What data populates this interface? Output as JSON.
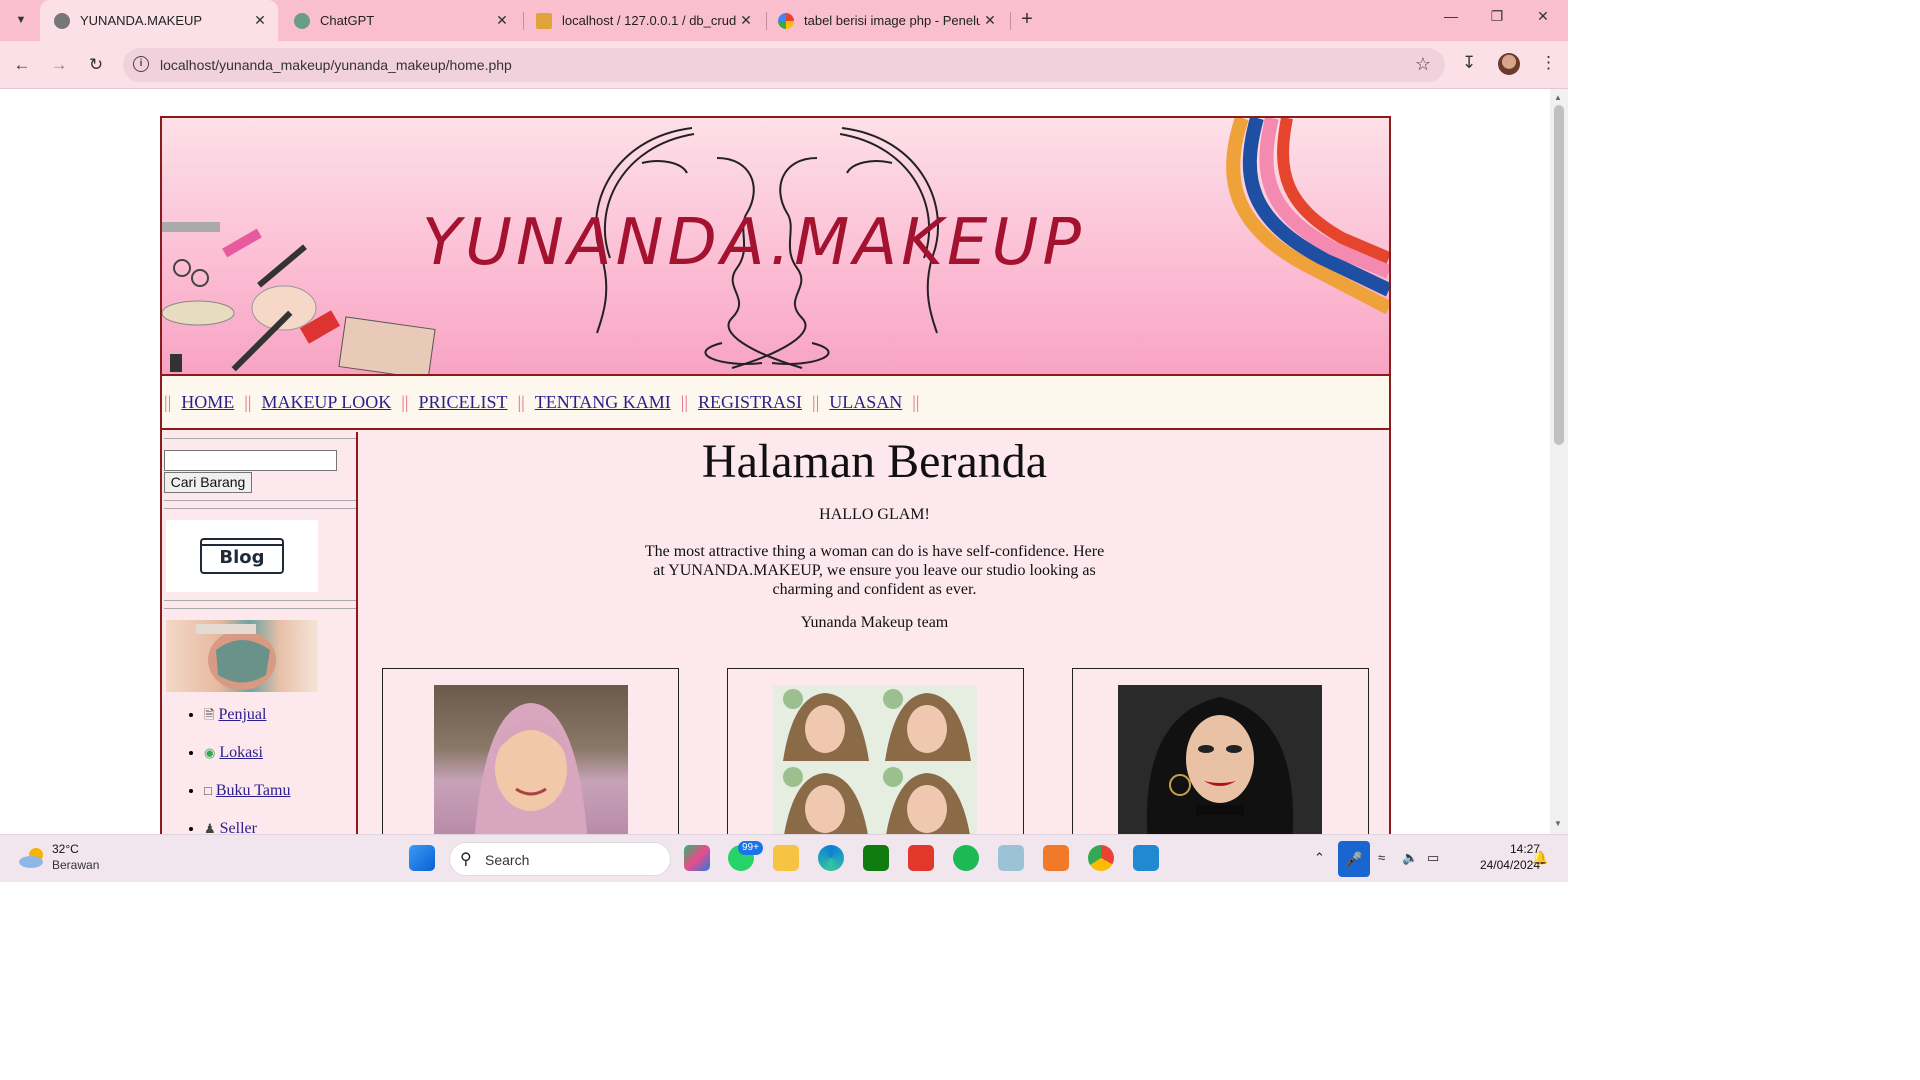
{
  "browser": {
    "tabs": [
      {
        "title": "YUNANDA.MAKEUP",
        "active": true
      },
      {
        "title": "ChatGPT",
        "active": false
      },
      {
        "title": "localhost / 127.0.0.1 / db_crud",
        "active": false
      },
      {
        "title": "tabel berisi image php - Penelu",
        "active": false
      }
    ],
    "url": "localhost/yunanda_makeup/yunanda_makeup/home.php"
  },
  "site": {
    "banner_title": "YUNANDA.MAKEUP",
    "menu": [
      {
        "label": "HOME"
      },
      {
        "label": "MAKEUP LOOK"
      },
      {
        "label": "PRICELIST"
      },
      {
        "label": "TENTANG KAMI"
      },
      {
        "label": "REGISTRASI"
      },
      {
        "label": "ULASAN"
      }
    ],
    "menu_separator": "||",
    "sidebar": {
      "search_button": "Cari Barang",
      "search_value": "",
      "blog_image_text": "Blog",
      "links": [
        {
          "label": "Penjual",
          "icon": "seller-card-icon"
        },
        {
          "label": "Lokasi",
          "icon": "map-pin-icon"
        },
        {
          "label": "Buku Tamu",
          "icon": "guestbook-icon"
        },
        {
          "label": "Seller",
          "icon": "person-icon"
        }
      ]
    },
    "content": {
      "heading": "Halaman Beranda",
      "greeting": "HALLO GLAM!",
      "paragraph": "The most attractive thing a woman can do is have self-confidence. Here at YUNANDA.MAKEUP, we ensure you leave our studio looking as charming and confident as ever.",
      "signature": "Yunanda Makeup team"
    }
  },
  "taskbar": {
    "weather_temp": "32°C",
    "weather_desc": "Berawan",
    "search_label": "Search",
    "notification_badge": "99+",
    "time": "14:27",
    "date": "24/04/2024"
  },
  "colors": {
    "tabbar": "#f9bfcf",
    "banner_title": "#a3122f",
    "border": "#8b1a1a",
    "menu_link": "#2a1f8c",
    "menu_separator": "#e26b8c"
  }
}
